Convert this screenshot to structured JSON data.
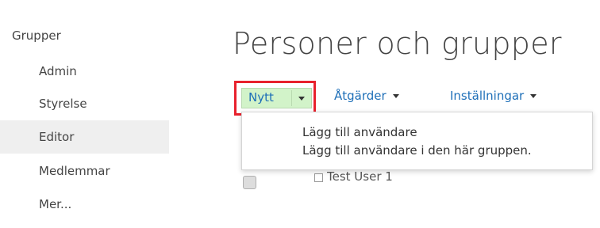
{
  "sidebar": {
    "heading": "Grupper",
    "items": [
      {
        "label": "Admin"
      },
      {
        "label": "Styrelse"
      },
      {
        "label": "Editor"
      },
      {
        "label": "Medlemmar"
      },
      {
        "label": "Mer..."
      }
    ],
    "selected_index": 2
  },
  "main": {
    "title": "Personer och grupper",
    "toolbar": {
      "new_label": "Nytt",
      "actions_label": "Åtgärder",
      "settings_label": "Inställningar"
    },
    "dropdown": {
      "items": [
        {
          "label": "Lägg till användare"
        },
        {
          "label": "Lägg till användare i den här gruppen."
        }
      ]
    },
    "list": {
      "rows": [
        {
          "name": "Test User 1"
        }
      ]
    }
  },
  "colors": {
    "highlight_border": "#e8212d",
    "new_button_bg": "#d2f3c9",
    "link": "#1e6fb8",
    "selected_bg": "#efefef"
  }
}
